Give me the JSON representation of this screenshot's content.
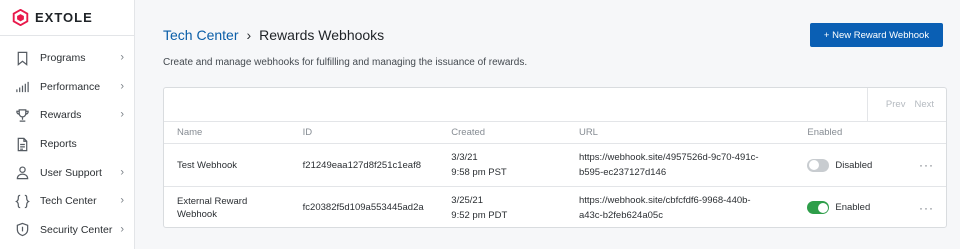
{
  "app": {
    "logo_text": "EXTOLE",
    "brand_color": "#e8194b"
  },
  "sidebar": {
    "items": [
      {
        "label": "Programs",
        "icon": "bookmark-icon"
      },
      {
        "label": "Performance",
        "icon": "bar-chart-icon"
      },
      {
        "label": "Rewards",
        "icon": "trophy-icon"
      },
      {
        "label": "Reports",
        "icon": "document-icon"
      },
      {
        "label": "User Support",
        "icon": "person-icon"
      },
      {
        "label": "Tech Center",
        "icon": "braces-icon"
      },
      {
        "label": "Security Center",
        "icon": "shield-icon"
      }
    ]
  },
  "header": {
    "breadcrumb_parent": "Tech Center",
    "breadcrumb_separator": "›",
    "breadcrumb_current": "Rewards Webhooks",
    "subtitle": "Create and manage webhooks for fulfilling and managing the issuance of rewards.",
    "new_button": "+ New Reward Webhook",
    "accent_color": "#0a5fb4"
  },
  "pager": {
    "prev": "Prev",
    "next": "Next"
  },
  "table": {
    "columns": [
      "Name",
      "ID",
      "Created",
      "URL",
      "Enabled"
    ],
    "rows": [
      {
        "name_line1": "Test Webhook",
        "name_line2": "",
        "id": "f21249eaa127d8f251c1eaf8",
        "created_date": "3/3/21",
        "created_time": "9:58 pm PST",
        "url_line1": "https://webhook.site/4957526d-9c70-491c-",
        "url_line2": "b595-ec237127d146",
        "enabled": false,
        "enabled_label": "Disabled",
        "more": "···"
      },
      {
        "name_line1": "External Reward",
        "name_line2": "Webhook",
        "id": "fc20382f5d109a553445ad2a",
        "created_date": "3/25/21",
        "created_time": "9:52 pm PDT",
        "url_line1": "https://webhook.site/cbfcfdf6-9968-440b-",
        "url_line2": "a43c-b2feb624a05c",
        "enabled": true,
        "enabled_label": "Enabled",
        "more": "···"
      }
    ]
  }
}
